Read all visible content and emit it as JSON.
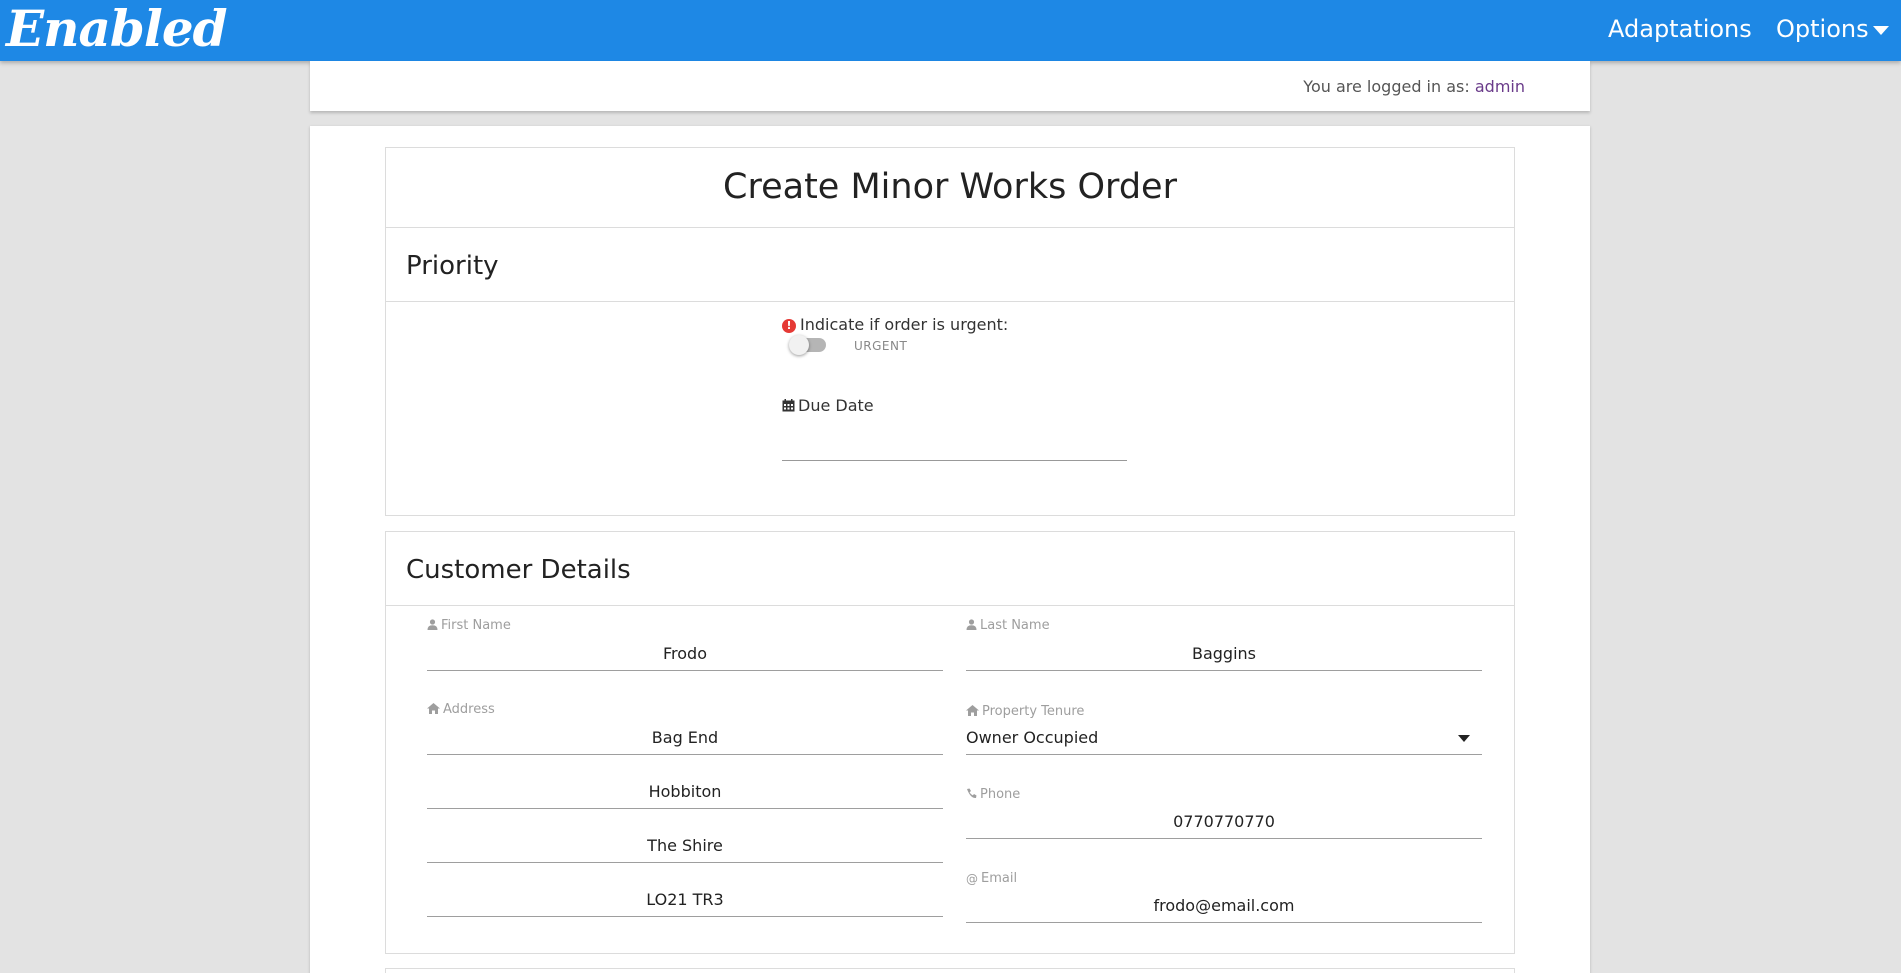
{
  "navbar": {
    "brand": "Enabled",
    "links": [
      "Adaptations",
      "Options"
    ],
    "accent": "#1e88e5"
  },
  "login": {
    "prefix": "You are logged in as:",
    "user": "admin"
  },
  "form": {
    "title": "Create Minor Works Order",
    "priority": {
      "heading": "Priority",
      "urgent_label": "Indicate if order is urgent:",
      "toggle_label": "URGENT",
      "urgent": false,
      "due_date_label": "Due Date",
      "due_date_value": ""
    },
    "customer": {
      "heading": "Customer Details",
      "first_name_label": "First Name",
      "first_name": "Frodo",
      "last_name_label": "Last Name",
      "last_name": "Baggins",
      "address_label": "Address",
      "address": [
        "Bag End",
        "Hobbiton",
        "The Shire",
        "LO21 TR3"
      ],
      "tenure_label": "Property Tenure",
      "tenure": "Owner Occupied",
      "phone_label": "Phone",
      "phone": "0770770770",
      "email_label": "Email",
      "email": "frodo@email.com"
    }
  }
}
